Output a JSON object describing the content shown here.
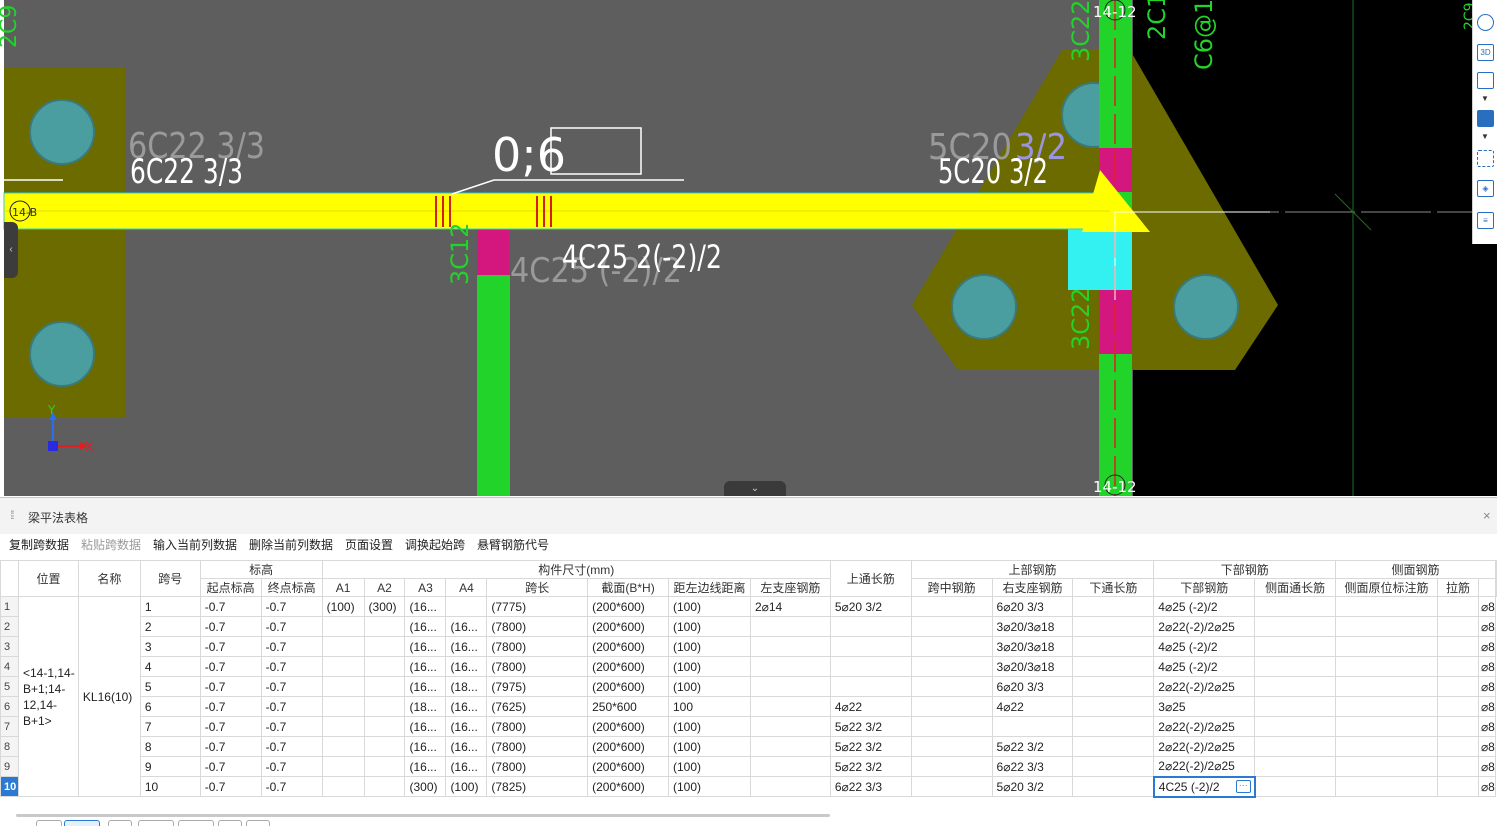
{
  "cad": {
    "colors": {
      "background": "#5e5e5e",
      "black_area": "#000000",
      "beam": "#ffff00",
      "column": "#6b6b00",
      "circle": "#4a9ea0",
      "green_beam": "#22d32a",
      "magenta": "#d4177f",
      "cyan": "#34f1f1"
    },
    "labels": {
      "top_left_green": "2C9",
      "upper_left_grey": "6C22 3/3",
      "upper_left_white": "6C22  3/3",
      "center_top": "0;6",
      "right_grey_a": "5C20",
      "right_grey_b": "3/2",
      "right_white": "5C20  3/2",
      "bottom_white": "4C25 2(-2)/2",
      "bottom_grey": "4C25 (-2)/2",
      "green_vertical": "3C12",
      "top_grid": "14-12",
      "bottom_grid": "14-12",
      "left_grid": "14-B",
      "right_top_green_a": "3C22",
      "right_top_green_b": "2C1",
      "right_top_green_c": "C6@10",
      "right_bottom_green": "3C22",
      "far_right": "2C9",
      "axis_y": "Y",
      "axis_x": "X"
    },
    "toolbar_icons": [
      "sphere-icon",
      "3d-icon",
      "cube-icon",
      "chevron-down-icon",
      "cube-blue-icon",
      "chevron-down-icon",
      "selection-icon",
      "box-icon",
      "list-icon"
    ],
    "toolbar_3d_label": "3D"
  },
  "panel": {
    "title": "梁平法表格",
    "close_icon": "×",
    "grip_icon": "⁞⁞",
    "toolbar": [
      {
        "label": "复制跨数据",
        "disabled": false
      },
      {
        "label": "粘贴跨数据",
        "disabled": true
      },
      {
        "label": "输入当前列数据",
        "disabled": false
      },
      {
        "label": "删除当前列数据",
        "disabled": false
      },
      {
        "label": "页面设置",
        "disabled": false
      },
      {
        "label": "调换起始跨",
        "disabled": false
      },
      {
        "label": "悬臂钢筋代号",
        "disabled": false
      }
    ],
    "headers": {
      "position": "位置",
      "name": "名称",
      "span": "跨号",
      "elevation": "标高",
      "start_elev": "起点标高",
      "end_elev": "终点标高",
      "size_group": "构件尺寸(mm)",
      "a1": "A1",
      "a2": "A2",
      "a3": "A3",
      "a4": "A4",
      "span_len": "跨长",
      "section": "截面(B*H)",
      "dist": "距左边线距离",
      "top_long": "上通长筋",
      "top_group": "上部钢筋",
      "left_support": "左支座钢筋",
      "mid_span": "跨中钢筋",
      "right_support": "右支座钢筋",
      "bottom_group": "下部钢筋",
      "bottom_long": "下通长筋",
      "bottom_bar": "下部钢筋",
      "side_group": "侧面钢筋",
      "side_long": "侧面通长筋",
      "side_orig": "侧面原位标注筋",
      "tie": "拉筋"
    },
    "position_value": "<14-1,14-B+1;14-12,14-B+1>",
    "name_value": "KL16(10)",
    "rows": [
      {
        "n": "1",
        "span": "1",
        "s": "-0.7",
        "e": "-0.7",
        "a1": "(100)",
        "a2": "(300)",
        "a3": "(16...",
        "a4": "",
        "len": "(7775)",
        "sec": "(200*600)",
        "dist": "(100)",
        "top": "2⌀14",
        "left": "5⌀20 3/2",
        "mid": "",
        "right": "6⌀20 3/3",
        "blong": "",
        "bbar": "4⌀25 (-2)/2",
        "slong": "",
        "sorig": "",
        "tie": "",
        "tail": "⌀8"
      },
      {
        "n": "2",
        "span": "2",
        "s": "-0.7",
        "e": "-0.7",
        "a1": "",
        "a2": "",
        "a3": "(16...",
        "a4": "(16...",
        "len": "(7800)",
        "sec": "(200*600)",
        "dist": "(100)",
        "top": "",
        "left": "",
        "mid": "",
        "right": "3⌀20/3⌀18",
        "blong": "",
        "bbar": "2⌀22(-2)/2⌀25",
        "slong": "",
        "sorig": "",
        "tie": "",
        "tail": "⌀8"
      },
      {
        "n": "3",
        "span": "3",
        "s": "-0.7",
        "e": "-0.7",
        "a1": "",
        "a2": "",
        "a3": "(16...",
        "a4": "(16...",
        "len": "(7800)",
        "sec": "(200*600)",
        "dist": "(100)",
        "top": "",
        "left": "",
        "mid": "",
        "right": "3⌀20/3⌀18",
        "blong": "",
        "bbar": "4⌀25 (-2)/2",
        "slong": "",
        "sorig": "",
        "tie": "",
        "tail": "⌀8"
      },
      {
        "n": "4",
        "span": "4",
        "s": "-0.7",
        "e": "-0.7",
        "a1": "",
        "a2": "",
        "a3": "(16...",
        "a4": "(16...",
        "len": "(7800)",
        "sec": "(200*600)",
        "dist": "(100)",
        "top": "",
        "left": "",
        "mid": "",
        "right": "3⌀20/3⌀18",
        "blong": "",
        "bbar": "4⌀25 (-2)/2",
        "slong": "",
        "sorig": "",
        "tie": "",
        "tail": "⌀8"
      },
      {
        "n": "5",
        "span": "5",
        "s": "-0.7",
        "e": "-0.7",
        "a1": "",
        "a2": "",
        "a3": "(16...",
        "a4": "(18...",
        "len": "(7975)",
        "sec": "(200*600)",
        "dist": "(100)",
        "top": "",
        "left": "",
        "mid": "",
        "right": "6⌀20 3/3",
        "blong": "",
        "bbar": "2⌀22(-2)/2⌀25",
        "slong": "",
        "sorig": "",
        "tie": "",
        "tail": "⌀8"
      },
      {
        "n": "6",
        "span": "6",
        "s": "-0.7",
        "e": "-0.7",
        "a1": "",
        "a2": "",
        "a3": "(18...",
        "a4": "(16...",
        "len": "(7625)",
        "sec": "250*600",
        "dist": "100",
        "top": "",
        "left": "4⌀22",
        "mid": "",
        "right": "4⌀22",
        "blong": "",
        "bbar": "3⌀25",
        "slong": "",
        "sorig": "",
        "tie": "",
        "tail": "⌀8"
      },
      {
        "n": "7",
        "span": "7",
        "s": "-0.7",
        "e": "-0.7",
        "a1": "",
        "a2": "",
        "a3": "(16...",
        "a4": "(16...",
        "len": "(7800)",
        "sec": "(200*600)",
        "dist": "(100)",
        "top": "",
        "left": "5⌀22 3/2",
        "mid": "",
        "right": "",
        "blong": "",
        "bbar": "2⌀22(-2)/2⌀25",
        "slong": "",
        "sorig": "",
        "tie": "",
        "tail": "⌀8"
      },
      {
        "n": "8",
        "span": "8",
        "s": "-0.7",
        "e": "-0.7",
        "a1": "",
        "a2": "",
        "a3": "(16...",
        "a4": "(16...",
        "len": "(7800)",
        "sec": "(200*600)",
        "dist": "(100)",
        "top": "",
        "left": "5⌀22 3/2",
        "mid": "",
        "right": "5⌀22 3/2",
        "blong": "",
        "bbar": "2⌀22(-2)/2⌀25",
        "slong": "",
        "sorig": "",
        "tie": "",
        "tail": "⌀8"
      },
      {
        "n": "9",
        "span": "9",
        "s": "-0.7",
        "e": "-0.7",
        "a1": "",
        "a2": "",
        "a3": "(16...",
        "a4": "(16...",
        "len": "(7800)",
        "sec": "(200*600)",
        "dist": "(100)",
        "top": "",
        "left": "5⌀22 3/2",
        "mid": "",
        "right": "6⌀22 3/3",
        "blong": "",
        "bbar": "2⌀22(-2)/2⌀25",
        "slong": "",
        "sorig": "",
        "tie": "",
        "tail": "⌀8"
      },
      {
        "n": "10",
        "span": "10",
        "s": "-0.7",
        "e": "-0.7",
        "a1": "",
        "a2": "",
        "a3": "(16...",
        "a4": "(300)",
        "len": "(7825)",
        "sec": "(200*600)",
        "dist": "(100)",
        "top": "",
        "left": "6⌀22 3/3",
        "mid": "",
        "right": "5⌀20 3/2",
        "blong": "",
        "bbar": "4C25 (-2)/2",
        "slong": "",
        "sorig": "",
        "tie": "",
        "tail": "⌀8"
      }
    ],
    "row10_a4": "(100)",
    "ellipsis_icon": "···",
    "highlight_color": "#7dbaf0",
    "selected_row_color": "#2a7ad4"
  }
}
